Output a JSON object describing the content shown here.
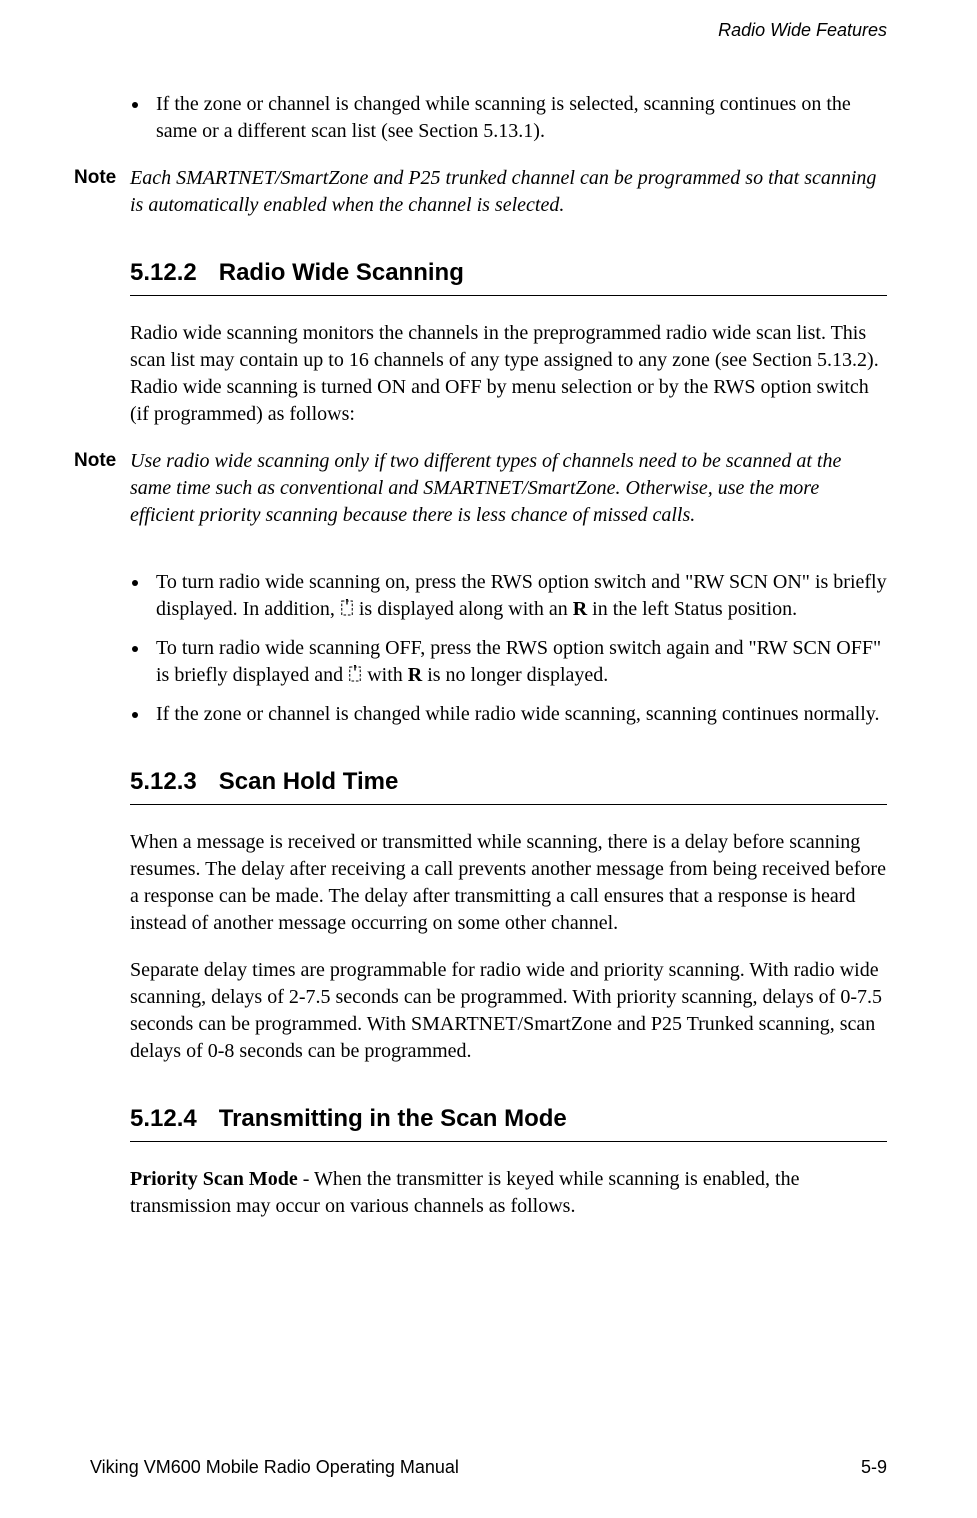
{
  "header": {
    "running": "Radio Wide Features"
  },
  "intro_bullet": "If the zone or channel is changed while scanning is selected, scanning continues on the same or a different scan list (see Section 5.13.1).",
  "note1": {
    "label": "Note",
    "text": "Each SMARTNET/SmartZone and P25 trunked channel can be programmed so that scanning is automatically enabled when the channel is selected."
  },
  "section_5_12_2": {
    "number": "5.12.2",
    "title": "Radio Wide Scanning",
    "p1": "Radio wide scanning monitors the channels in the preprogrammed radio wide scan list. This scan list may contain up to 16 channels of any type assigned to any zone (see Section 5.13.2). Radio wide scanning is turned ON and OFF by menu selection or by the RWS option switch (if programmed) as follows:",
    "note": {
      "label": "Note",
      "text": "Use radio wide scanning only if two different types of channels need to be scanned at the same time such as conventional and SMARTNET/SmartZone. Otherwise, use the more efficient priority scanning because there is less chance of missed calls."
    },
    "bullets": {
      "b1_a": "To turn radio wide scanning on, press the RWS option switch and \"RW SCN ON\" is briefly displayed. In addition, ",
      "b1_b": " is displayed along with an ",
      "b1_c": " in the left Status position.",
      "b1_r": "R",
      "b2_a": "To turn radio wide scanning OFF, press the RWS option switch again and \"RW SCN OFF\" is briefly displayed and ",
      "b2_b": " with ",
      "b2_c": " is no longer displayed.",
      "b2_r": "R",
      "b3": "If the zone or channel is changed while radio wide scanning, scanning continues normally."
    }
  },
  "section_5_12_3": {
    "number": "5.12.3",
    "title": "Scan Hold Time",
    "p1": "When a message is received or transmitted while scanning, there is a delay before scanning resumes. The delay after receiving a call prevents another message from being received before a response can be made. The delay after transmitting a call ensures that a response is heard instead of another message occurring on some other channel.",
    "p2": "Separate delay times are programmable for radio wide and priority scanning. With radio wide scanning, delays of 2-7.5 seconds can be programmed. With priority scanning, delays of 0-7.5 seconds can be programmed. With SMARTNET/SmartZone and P25 Trunked scanning, scan delays of 0-8 seconds can be programmed."
  },
  "section_5_12_4": {
    "number": "5.12.4",
    "title": "Transmitting in the Scan Mode",
    "p1_bold": "Priority Scan Mode",
    "p1_rest": " - When the transmitter is keyed while scanning is enabled, the transmission may occur on various channels as follows."
  },
  "footer": {
    "left": "Viking VM600 Mobile Radio Operating Manual",
    "right": "5-9"
  },
  "icons": {
    "scan": "scan-icon"
  }
}
